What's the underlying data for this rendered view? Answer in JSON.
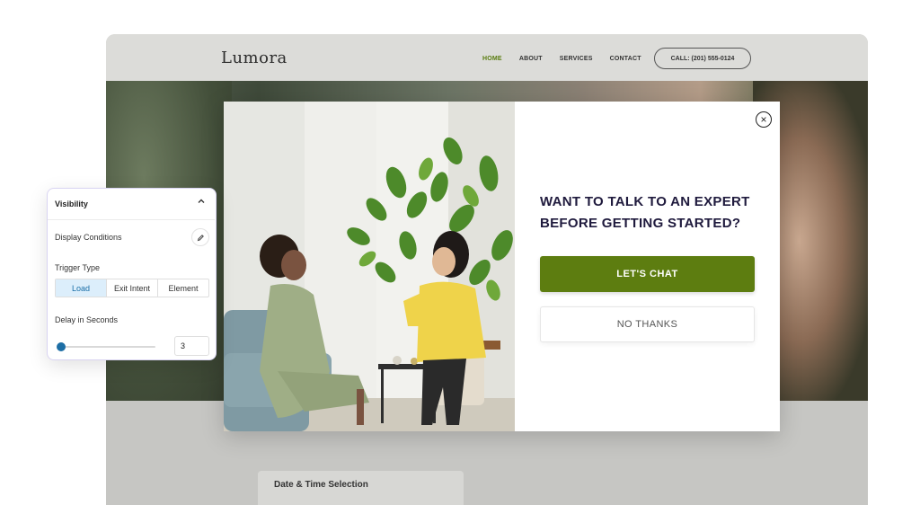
{
  "site": {
    "logo": "Lumora",
    "nav": [
      "HOME",
      "ABOUT",
      "SERVICES",
      "CONTACT"
    ],
    "active_nav": "HOME",
    "call_label": "CALL: (201) 555-0124",
    "below_card_label": "Date & Time Selection"
  },
  "popup": {
    "headline": "WANT TO TALK TO AN EXPERT BEFORE GETTING STARTED?",
    "primary_label": "LET'S CHAT",
    "secondary_label": "NO THANKS",
    "close_icon": "close-circle-icon",
    "image_icon": "two-women-chatting-photo"
  },
  "panel": {
    "title": "Visibility",
    "chevron_icon": "chevron-up-icon",
    "display_conditions_label": "Display Conditions",
    "edit_icon": "pencil-icon",
    "trigger_type_label": "Trigger Type",
    "trigger_options": [
      "Load",
      "Exit Intent",
      "Element"
    ],
    "trigger_selected": "Load",
    "delay_label": "Delay in Seconds",
    "delay_value": "3",
    "delay_slider_fraction": 0.05
  },
  "colors": {
    "brand_green": "#5d7d10",
    "headline": "#1f1a3d",
    "panel_accent": "#1d6ea5",
    "selected_bg": "#dceefb"
  }
}
